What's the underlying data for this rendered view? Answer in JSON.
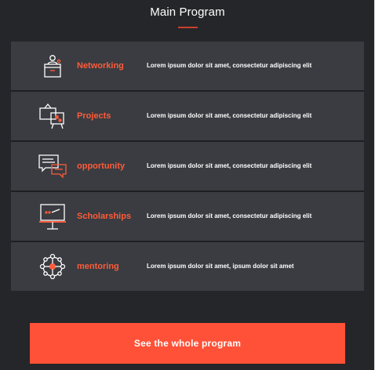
{
  "header": {
    "title": "Main Program"
  },
  "program": {
    "items": [
      {
        "label": "Networking",
        "description": "Lorem ipsum dolor sit amet, consectetur adipiscing elit",
        "icon": "podium-icon"
      },
      {
        "label": "Projects",
        "description": "Lorem ipsum dolor sit amet, consectetur adipiscing elit",
        "icon": "easel-board-icon"
      },
      {
        "label": "opportunity",
        "description": "Lorem ipsum dolor sit amet, consectetur adipiscing elit",
        "icon": "chat-bubbles-icon"
      },
      {
        "label": "Scholarships",
        "description": "Lorem ipsum dolor sit amet, consectetur adipiscing elit",
        "icon": "whiteboard-icon"
      },
      {
        "label": "mentoring",
        "description": "Lorem ipsum dolor sit amet, ipsum dolor sit amet",
        "icon": "network-icon"
      }
    ]
  },
  "cta": {
    "label": "See the whole program"
  },
  "colors": {
    "background": "#252629",
    "row": "#3a3c41",
    "accent": "#ff5b3a",
    "button": "#ff5137",
    "text": "#ffffff"
  }
}
